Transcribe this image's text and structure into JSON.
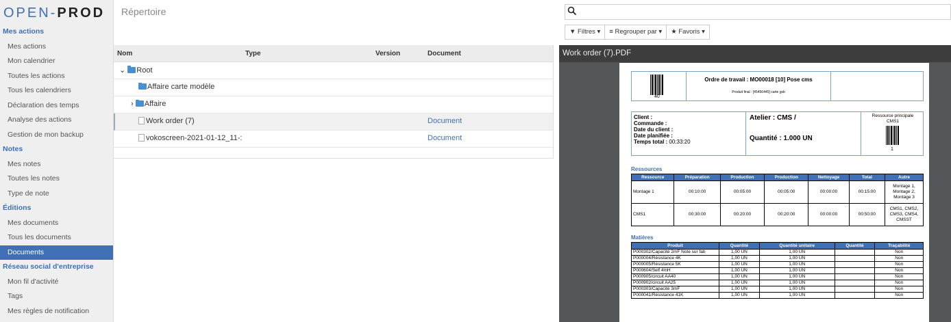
{
  "sidebar": {
    "logo_left": "OPEN-",
    "logo_right": "PROD",
    "sections": [
      {
        "title": "Mes actions",
        "items": [
          "Mes actions",
          "Mon calendrier",
          "Toutes les actions",
          "Tous les calendriers",
          "Déclaration des temps",
          "Analyse des actions",
          "Gestion de mon backup"
        ]
      },
      {
        "title": "Notes",
        "items": [
          "Mes notes",
          "Toutes les notes",
          "Type de note"
        ]
      },
      {
        "title": "Éditions",
        "items": [
          "Mes documents",
          "Tous les documents",
          "Documents"
        ]
      },
      {
        "title": "Réseau social d'entreprise",
        "items": [
          "Mon fil d'activité",
          "Tags",
          "Mes règles de notification"
        ]
      }
    ],
    "active_item": "Documents"
  },
  "header": {
    "title": "Répertoire",
    "search_placeholder": "",
    "filters_label": "Filtres ▾",
    "group_label": "Regrouper par ▾",
    "favorites_label": "Favoris ▾"
  },
  "list": {
    "columns": [
      "Nom",
      "Type",
      "Version",
      "Document"
    ],
    "rows": [
      {
        "name": "Root",
        "document": ""
      },
      {
        "name": "Affaire carte modèle",
        "document": ""
      },
      {
        "name": "Affaire",
        "document": ""
      },
      {
        "name": "Work order (7)",
        "document": "Document"
      },
      {
        "name": "vokoscreen-2021-01-12_11-:",
        "document": "Document"
      }
    ]
  },
  "pdf": {
    "filename": "Work order (7).PDF",
    "wo_title": "Ordre de travail : MO00018 [10] Pose cms",
    "wo_subtitle": "Produit final : [45456445] carte gsb",
    "barcode_num": "40",
    "client": "Client :",
    "commande": "Commande :",
    "date_client": "Date du client :",
    "date_planifiee": "Date planifiée :",
    "temps_total_label": "Temps total :",
    "temps_total": "00:33:20",
    "atelier": "Atelier : CMS /",
    "quantite": "Quantité : 1.000 UN",
    "res_principale": "Ressource principale",
    "res_name": "CMS1",
    "res_code": "1",
    "ressources_title": "Ressources",
    "res_cols": [
      "Ressource",
      "Préparation",
      "Production",
      "Production",
      "Nettoyage",
      "Total",
      "Autre"
    ],
    "res_rows": [
      [
        "Montage 1",
        "00:10:00",
        "00:05:00",
        "00:05:00",
        "00:00:00",
        "00:15:00",
        "Montage 1, Montage 2, Montage 3"
      ],
      [
        "CMS1",
        "00:30:00",
        "00:20:00",
        "00:20:00",
        "00:00:00",
        "00:50:00",
        "CMS1, CMS2, CMS3, CMS4, CMSST"
      ]
    ],
    "matieres_title": "Matières",
    "mat_cols": [
      "Produit",
      "Quantité",
      "Quantité unitaire",
      "Quantité",
      "Traçabilité"
    ],
    "mat_rows": [
      [
        "P000302/Capacité 2mF Note sur fab",
        "1,00 UN",
        "1,00 UN",
        "",
        "Non"
      ],
      [
        "P000004/Résistance 4K",
        "1,00 UN",
        "1,00 UN",
        "",
        "Non"
      ],
      [
        "P000005/Résistance 5K",
        "1,00 UN",
        "1,00 UN",
        "",
        "Non"
      ],
      [
        "P000604/Self 4mH",
        "1,00 UN",
        "1,00 UN",
        "",
        "Non"
      ],
      [
        "P000905/circuit AA40",
        "1,00 UN",
        "1,00 UN",
        "",
        "Non"
      ],
      [
        "P000902/circuit AA25",
        "1,00 UN",
        "1,00 UN",
        "",
        "Non"
      ],
      [
        "P000303/Capacité 3mF",
        "1,00 UN",
        "1,00 UN",
        "",
        "Non"
      ],
      [
        "P000041/Résistance 41K",
        "1,00 UN",
        "1,00 UN",
        "",
        "Non"
      ]
    ]
  }
}
